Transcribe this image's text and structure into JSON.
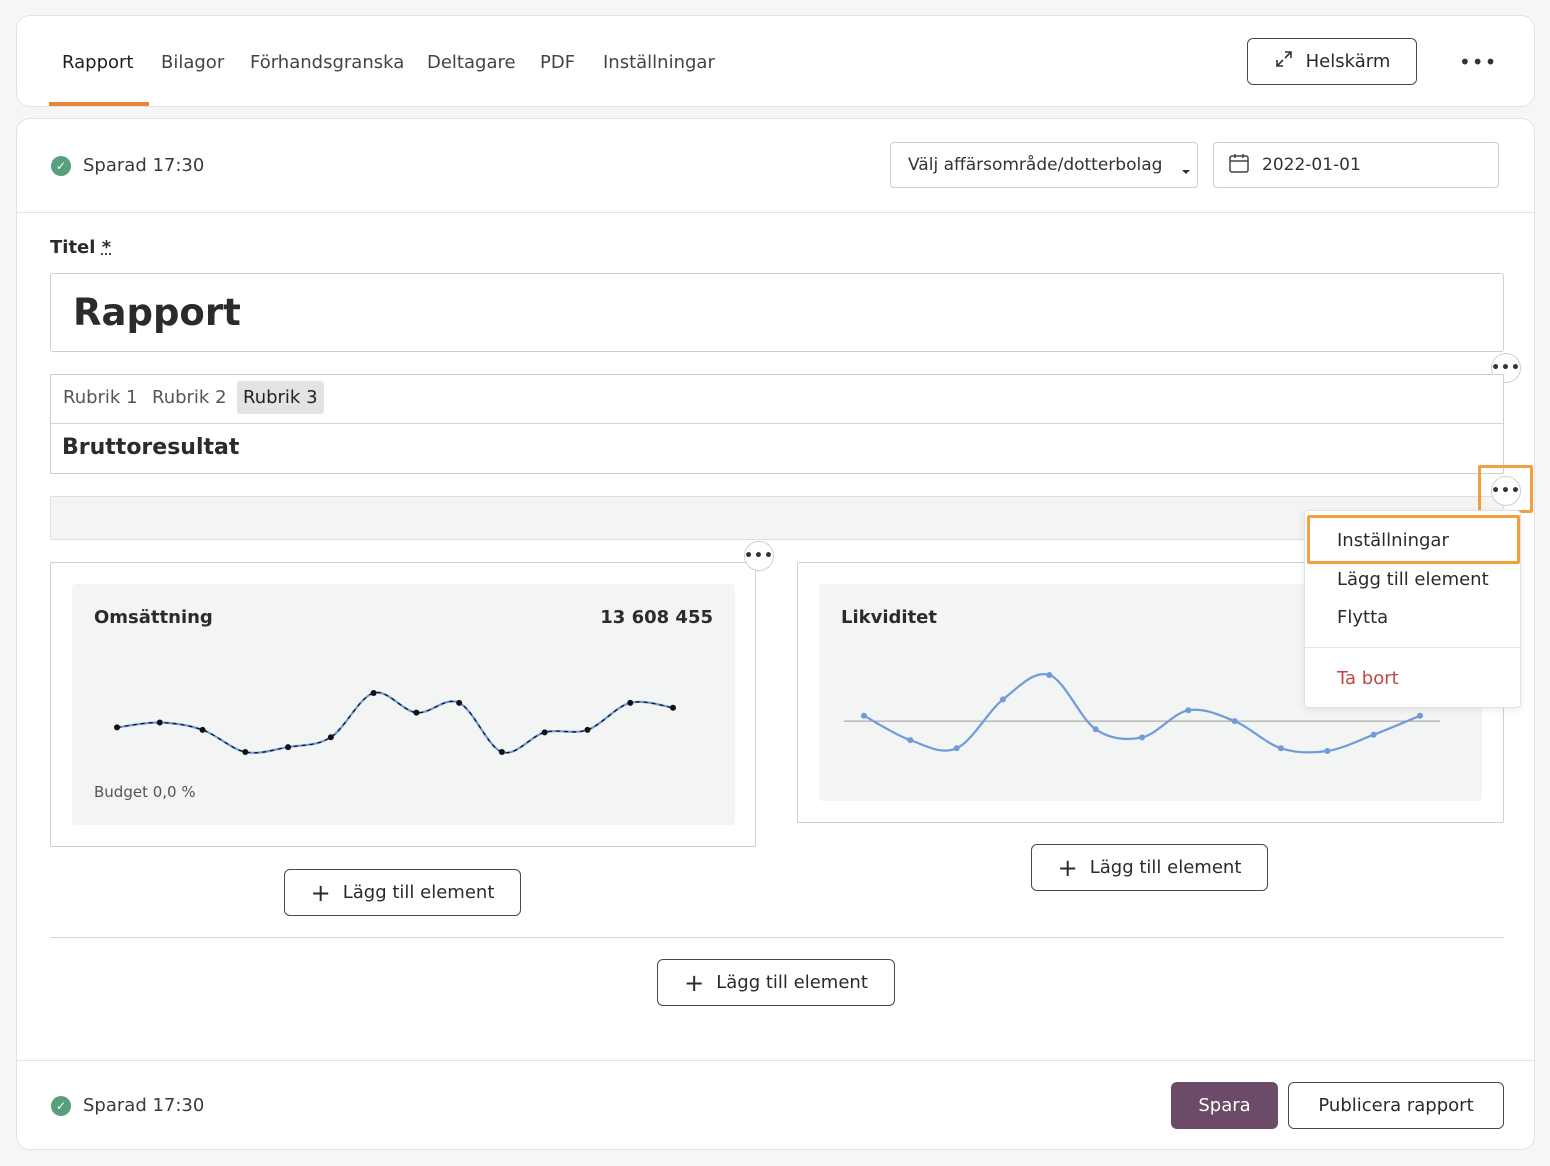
{
  "tabs": [
    {
      "label": "Rapport",
      "active": true
    },
    {
      "label": "Bilagor"
    },
    {
      "label": "Förhandsgranska"
    },
    {
      "label": "Deltagare"
    },
    {
      "label": "PDF"
    },
    {
      "label": "Inställningar"
    }
  ],
  "header": {
    "fullscreen_label": "Helskärm",
    "more": "•••"
  },
  "toolbar": {
    "saved_text": "Sparad 17:30",
    "business_area_placeholder": "Välj affärsområde/dotterbolag",
    "date": "2022-01-01"
  },
  "form": {
    "title_label": "Titel",
    "required_mark": "*",
    "title_value": "Rapport"
  },
  "heading_block": {
    "options": [
      "Rubrik 1",
      "Rubrik 2",
      "Rubrik 3"
    ],
    "selected": "Rubrik 3",
    "text": "Bruttoresultat"
  },
  "widgets": {
    "revenue": {
      "title": "Omsättning",
      "value": "13 608 455",
      "footer": "Budget 0,0 %"
    },
    "liquidity": {
      "title": "Likviditet"
    }
  },
  "chart_data": [
    {
      "type": "line",
      "title": "Omsättning",
      "series": [
        {
          "values": [
            10.6,
            10.8,
            10.5,
            9.6,
            9.8,
            10.2,
            12.0,
            11.2,
            11.6,
            9.6,
            10.4,
            10.5,
            11.6,
            11.4
          ]
        }
      ]
    },
    {
      "type": "line",
      "title": "Likviditet",
      "baseline": 0,
      "series": [
        {
          "values": [
            0.2,
            -0.7,
            -1.0,
            0.8,
            1.7,
            -0.3,
            -0.6,
            0.4,
            0.0,
            -1.0,
            -1.1,
            -0.5,
            0.2
          ]
        }
      ]
    }
  ],
  "menu": {
    "items": [
      "Inställningar",
      "Lägg till element",
      "Flytta"
    ],
    "danger_item": "Ta bort"
  },
  "add_element_label": "Lägg till element",
  "footer": {
    "saved_text": "Sparad 17:30",
    "save_label": "Spara",
    "publish_label": "Publicera rapport"
  },
  "colors": {
    "accent": "#e8843c",
    "primary": "#6b4b67",
    "success": "#56a07d",
    "danger": "#c0484a",
    "highlight": "#f0a03c",
    "chart_line": "#6f9bd8"
  }
}
